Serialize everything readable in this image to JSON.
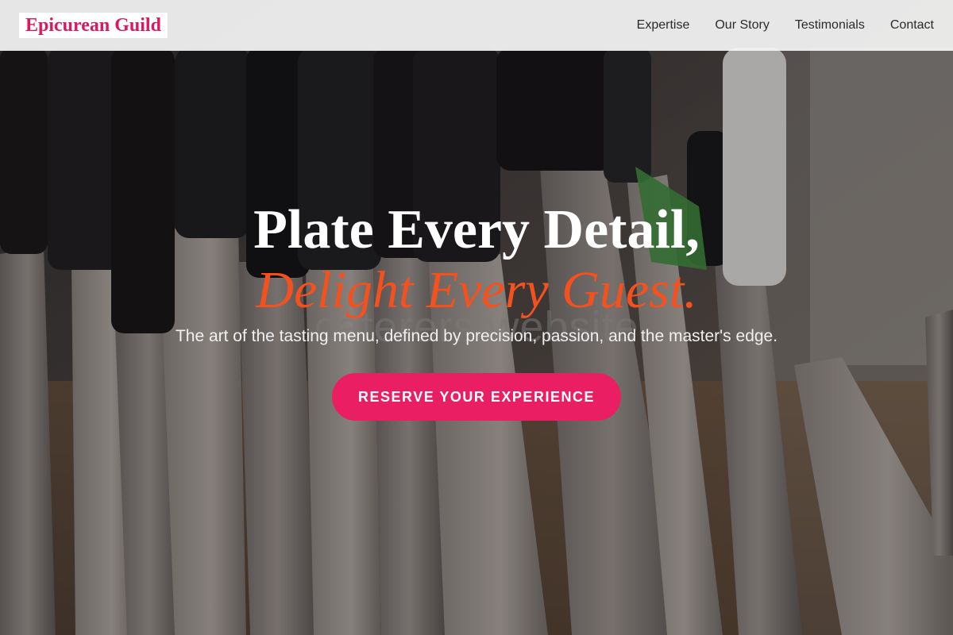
{
  "navbar": {
    "brand": "Epicurean Guild",
    "links": [
      "Expertise",
      "Our Story",
      "Testimonials",
      "Contact"
    ]
  },
  "hero": {
    "headline_line1": "Plate Every Detail,",
    "headline_line2": "Delight Every Guest.",
    "watermark": "caterers.website",
    "subtitle": "The art of the tasting menu, defined by precision, passion, and the master's edge.",
    "cta_label": "RESERVE YOUR EXPERIENCE",
    "background_icon": "knife-rack-photo"
  },
  "colors": {
    "brand": "#d81b60",
    "accent_headline": "#f4511e",
    "cta": "#e91e63",
    "navbar_bg": "#f5f5f5"
  }
}
